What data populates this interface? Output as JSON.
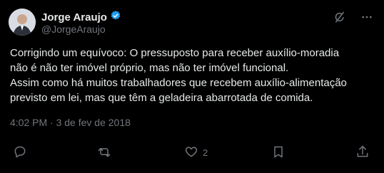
{
  "author": {
    "name": "Jorge Araujo",
    "handle": "@JorgeAraujo",
    "verified_color": "#1d9bf0"
  },
  "top_icons": [
    "grok-icon",
    "more-icon"
  ],
  "tweet": {
    "text": "Corrigindo um equívoco: O pressuposto para receber auxílio-moradia\nnão é não ter imóvel próprio, mas não ter imóvel funcional.\nAssim como há muitos trabalhadores que recebem auxílio-alimentação\nprevisto em lei, mas que têm a geladeira abarrotada de comida.",
    "timestamp": "4:02 PM · 3 de fev de 2018"
  },
  "actions": {
    "reply_count": "",
    "retweet_count": "",
    "like_count": "2",
    "share_count": ""
  },
  "colors": {
    "background": "#000000",
    "text": "#e7e9ea",
    "secondary": "#71767b",
    "accent": "#1d9bf0"
  }
}
